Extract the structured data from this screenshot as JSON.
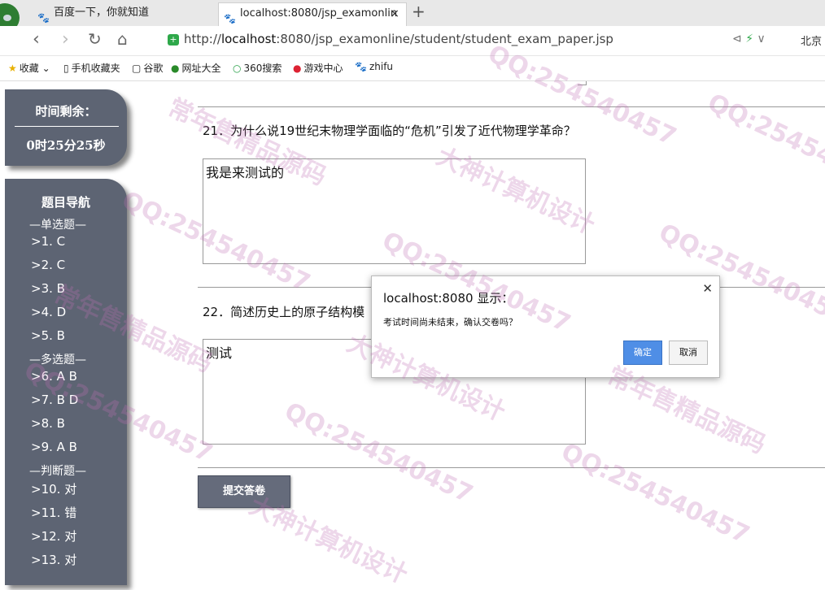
{
  "browser": {
    "tabs": [
      {
        "label": "百度一下，你就知道",
        "icon": "paw-icon"
      },
      {
        "label": "localhost:8080/jsp_examonlin",
        "icon": "paw-icon",
        "active": true
      }
    ],
    "new_tab": "+",
    "close": "×",
    "url_host": "localhost",
    "url_prefix": "http://",
    "url_rest": ":8080/jsp_examonline/student/student_exam_paper.jsp",
    "location": "北京",
    "bookmarks": [
      {
        "label": "收藏",
        "icon": "star-icon"
      },
      {
        "label": "手机收藏夹",
        "icon": "phone-icon"
      },
      {
        "label": "谷歌",
        "icon": "page-icon"
      },
      {
        "label": "网址大全",
        "icon": "globe-icon"
      },
      {
        "label": "360搜索",
        "icon": "search-icon"
      },
      {
        "label": "游戏中心",
        "icon": "game-icon"
      },
      {
        "label": "zhifu",
        "icon": "paw-icon"
      }
    ]
  },
  "timer": {
    "label": "时间剩余：",
    "value": "0时25分25秒"
  },
  "question_nav": {
    "title": "题目导航",
    "sections": [
      "—单选题—",
      "—多选题—",
      "—判断题—"
    ],
    "single": [
      ">1.  C",
      ">2.  C",
      ">3.  B",
      ">4.  D",
      ">5.  B"
    ],
    "multi": [
      ">6.  A B",
      ">7.  B D",
      ">8.  B",
      ">9.  A B"
    ],
    "judge": [
      ">10. 对",
      ">11. 错",
      ">12. 对",
      ">13. 对"
    ]
  },
  "questions": [
    {
      "text": "21．为什么说19世纪末物理学面临的“危机”引发了近代物理学革命？",
      "answer": "我是来测试的"
    },
    {
      "text": "22．简述历史上的原子结构模",
      "answer": "测试"
    }
  ],
  "submit_label": "提交答卷",
  "dialog": {
    "title": "localhost:8080 显示：",
    "message": "考试时间尚未结束，确认交卷吗？",
    "ok": "确定",
    "cancel": "取消"
  },
  "watermarks": [
    "QQ:254540457",
    "大神计算机设计",
    "常年售精品源码"
  ]
}
